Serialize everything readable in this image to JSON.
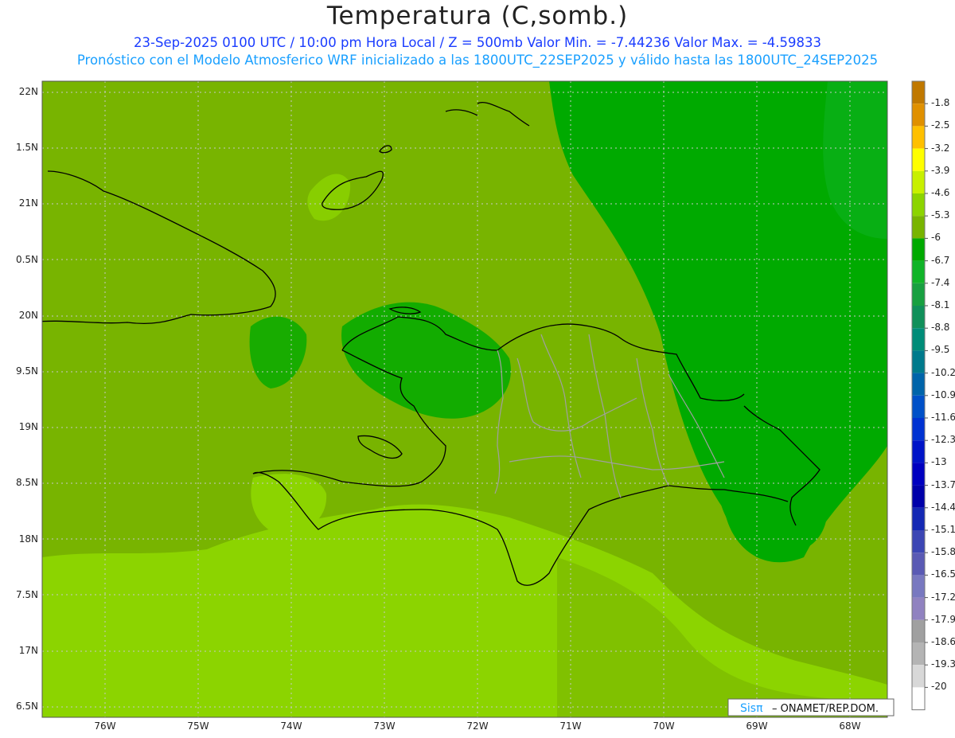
{
  "title": "Temperatura (C,somb.)",
  "subtitle1": "23-Sep-2025  0100 UTC / 10:00 pm Hora Local / Z = 500mb  Valor Min. = -7.44236  Valor Max. = -4.59833",
  "subtitle2": "Pronóstico con el Modelo Atmosferico WRF inicializado a las 1800UTC_22SEP2025 y válido hasta las  1800UTC_24SEP2025",
  "lat_labels": [
    "22N",
    "1.5N",
    "21N",
    "0.5N",
    "20N",
    "9.5N",
    "19N",
    "8.5N",
    "18N",
    "7.5N",
    "17N",
    "6.5N"
  ],
  "lon_labels": [
    "76W",
    "75W",
    "74W",
    "73W",
    "72W",
    "71W",
    "70W",
    "69W",
    "68W"
  ],
  "colorbar": {
    "labels": [
      "-1.8",
      "-2.5",
      "-3.2",
      "-3.9",
      "-4.6",
      "-5.3",
      "-6",
      "-6.7",
      "-7.4",
      "-8.1",
      "-8.8",
      "-9.5",
      "-10.2",
      "-10.9",
      "-11.6",
      "-12.3",
      "-13",
      "-13.7",
      "-14.4",
      "-15.1",
      "-15.8",
      "-16.5",
      "-17.2",
      "-17.9",
      "-18.6",
      "-19.3",
      "-20"
    ],
    "colors": [
      "#c07800",
      "#e09000",
      "#ffc000",
      "#ffff00",
      "#c8f000",
      "#8cd400",
      "#78b400",
      "#00aa00",
      "#10b428",
      "#18a040",
      "#10905a",
      "#008c78",
      "#007a8c",
      "#0064aa",
      "#0050c8",
      "#0032d2",
      "#0014c8",
      "#0000c0",
      "#0000aa",
      "#1428b4",
      "#3c46b4",
      "#5a5ab4",
      "#7878c0",
      "#9082c0",
      "#a0a0a0",
      "#b4b4b4",
      "#d8d8d8",
      "#ffffff"
    ]
  },
  "credit": {
    "brand": "Sisπ",
    "org": " – ONAMET/REP.DOM."
  }
}
